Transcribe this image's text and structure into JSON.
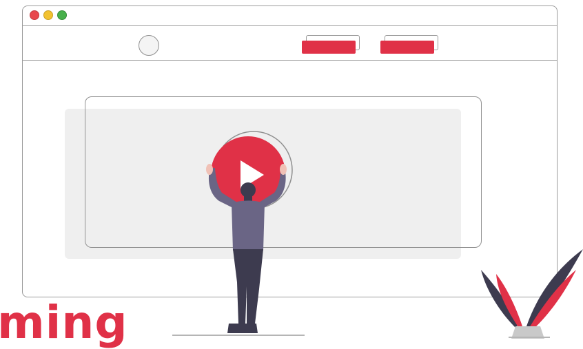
{
  "window": {
    "controls": [
      "close",
      "minimize",
      "maximize"
    ],
    "colors": {
      "close": "#e8484d",
      "minimize": "#f2c230",
      "maximize": "#47b04b"
    }
  },
  "navbar": {
    "logo_icon": "circle-logo-icon",
    "buttons": [
      {
        "name": "nav-button-1",
        "label": ""
      },
      {
        "name": "nav-button-2",
        "label": ""
      }
    ]
  },
  "video": {
    "play_icon": "play-icon",
    "accent_color": "#e03147"
  },
  "headline": {
    "text": "ming"
  },
  "illustration": {
    "person": "person-holding-play-button",
    "plant": "potted-plant",
    "colors": {
      "shirt": "#6a6585",
      "pants": "#3d3b4f",
      "leaf_dark": "#3d3b4f",
      "leaf_red": "#e03147"
    }
  }
}
